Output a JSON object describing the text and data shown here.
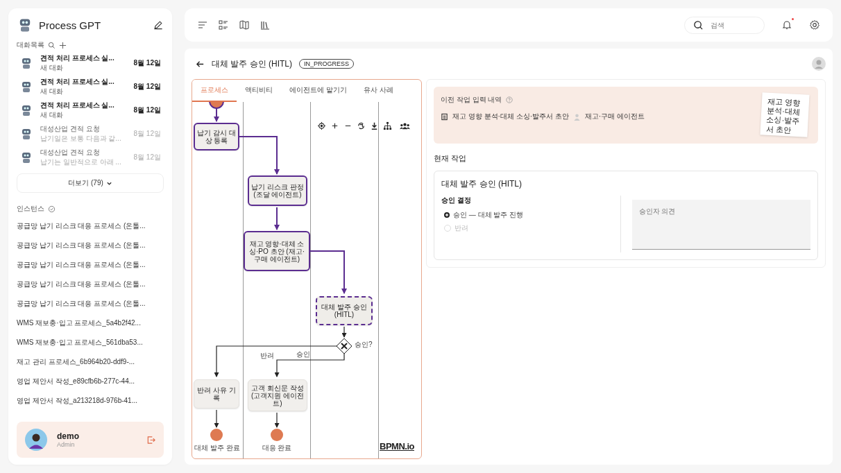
{
  "sidebar": {
    "brand": "Process GPT",
    "chats": {
      "title": "대화목록",
      "items": [
        {
          "title": "견적 처리 프로세스 실...",
          "subtitle": "새 대화",
          "date": "8월 12일",
          "unread": true
        },
        {
          "title": "견적 처리 프로세스 실...",
          "subtitle": "새 대화",
          "date": "8월 12일",
          "unread": true
        },
        {
          "title": "견적 처리 프로세스 실...",
          "subtitle": "새 대화",
          "date": "8월 12일",
          "unread": true
        },
        {
          "title": "대성산업 견적 요청",
          "subtitle": "납기일은 보통 다음과 같...",
          "date": "8월 12일",
          "unread": false
        },
        {
          "title": "대성산업 견적 요청",
          "subtitle": "납기는 일반적으로 아래 ...",
          "date": "8월 12일",
          "unread": false
        }
      ]
    },
    "more_button": "더보기 (79)",
    "instances": {
      "title": "인스턴스",
      "items": [
        "공급망 납기 리스크 대응 프로세스 (온톨...",
        "공급망 납기 리스크 대응 프로세스 (온톨...",
        "공급망 납기 리스크 대응 프로세스 (온톨...",
        "공급망 납기 리스크 대응 프로세스 (온톨...",
        "공급망 납기 리스크 대응 프로세스 (온톨...",
        "WMS 재보충·입고 프로세스_5a4b2f42...",
        "WMS 재보충·입고 프로세스_561dba53...",
        "재고 관리 프로세스_6b964b20-ddf9-...",
        "영업 제안서 작성_e89cfb6b-277c-44...",
        "영업 제안서 작성_a213218d-976b-41..."
      ]
    },
    "user": {
      "name": "demo",
      "role": "Admin"
    }
  },
  "topbar": {
    "search": {
      "placeholder": "검색"
    },
    "has_notification": true
  },
  "task": {
    "title": "대체 발주 승인 (HITL)",
    "status": "IN_PROGRESS"
  },
  "diagram": {
    "tabs": [
      {
        "label": "프로세스",
        "selected": true
      },
      {
        "label": "액티비티",
        "selected": false
      },
      {
        "label": "에이전트에 맡기기",
        "selected": false
      },
      {
        "label": "유사 사례",
        "selected": false
      }
    ],
    "nodes": [
      {
        "kind": "task",
        "label": "납기 감시 대상 등록",
        "completed": true,
        "current": false
      },
      {
        "kind": "task",
        "label": "납기 리스크 판정 (조달 에이전트)",
        "completed": true,
        "current": false
      },
      {
        "kind": "task",
        "label": "재고 영향·대체 소싱·PO 초안 (재고·구매 에이전트)",
        "completed": true,
        "current": false
      },
      {
        "kind": "task",
        "label": "대체 발주 승인 (HITL)",
        "completed": false,
        "current": true
      },
      {
        "kind": "gateway",
        "label": "승인?"
      },
      {
        "kind": "task",
        "label": "반려 사유 기록",
        "completed": false,
        "current": false
      },
      {
        "kind": "task",
        "label": "고객 회신문 작성 (고객지원 에이전트)",
        "completed": false,
        "current": false
      },
      {
        "kind": "end",
        "label": "대체 발주 완료"
      },
      {
        "kind": "end",
        "label": "대응 완료"
      }
    ],
    "edge_labels": [
      "반려",
      "승인"
    ],
    "watermark": "BPMN.io"
  },
  "previous": {
    "title": "이전 작업 입력 내역",
    "output": "재고 영향 분석·대체 소싱·발주서 초안",
    "agent": "재고·구매 에이전트",
    "note": "재고 영향 분석·대체 소싱·발주서 초안"
  },
  "current": {
    "heading": "현재 작업",
    "form_title": "대체 발주 승인 (HITL)",
    "field_label": "승인 결정",
    "options": [
      {
        "label": "승인 — 대체 발주 진행",
        "selected": true
      },
      {
        "label": "반려",
        "selected": false
      }
    ],
    "comment": {
      "placeholder": "승인자 의견"
    }
  }
}
